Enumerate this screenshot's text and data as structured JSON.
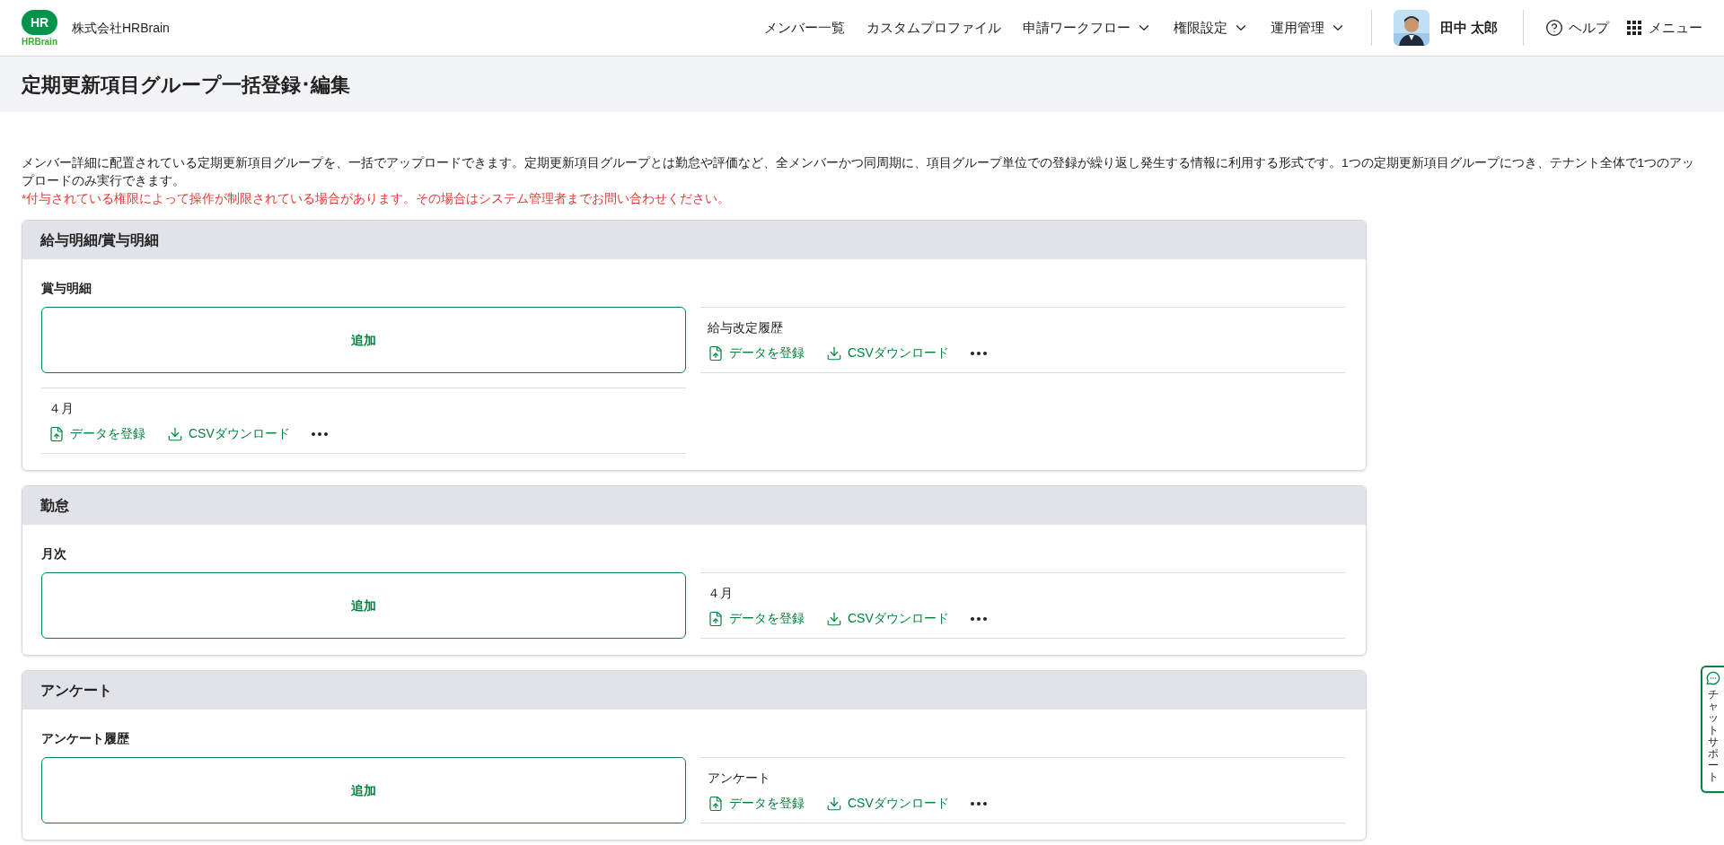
{
  "header": {
    "logo_mark": "HR",
    "logo_word": "HRBrain",
    "company": "株式会社HRBrain",
    "nav": [
      {
        "label": "メンバー一覧",
        "dropdown": false
      },
      {
        "label": "カスタムプロファイル",
        "dropdown": false
      },
      {
        "label": "申請ワークフロー",
        "dropdown": true
      },
      {
        "label": "権限設定",
        "dropdown": true
      },
      {
        "label": "運用管理",
        "dropdown": true
      }
    ],
    "user": {
      "name": "田中 太郎"
    },
    "help": "ヘルプ",
    "menu": "メニュー"
  },
  "page_title": "定期更新項目グループ一括登録･編集",
  "description": "メンバー詳細に配置されている定期更新項目グループを、一括でアップロードできます。定期更新項目グループとは勤怠や評価など、全メンバーかつ同周期に、項目グループ単位での登録が繰り返し発生する情報に利用する形式です。1つの定期更新項目グループにつき、テナント全体で1つのアップロードのみ実行できます。",
  "notice": "*付与されている権限によって操作が制限されている場合があります。その場合はシステム管理者までお問い合わせください。",
  "sections": [
    {
      "title": "給与明細/賞与明細",
      "group": "賞与明細",
      "add_label": "追加",
      "items": [
        {
          "name": "給与改定履歴",
          "register": "データを登録",
          "download": "CSVダウンロード"
        },
        {
          "name": "４月",
          "register": "データを登録",
          "download": "CSVダウンロード"
        }
      ]
    },
    {
      "title": "勤怠",
      "group": "月次",
      "add_label": "追加",
      "items": [
        {
          "name": "４月",
          "register": "データを登録",
          "download": "CSVダウンロード"
        }
      ]
    },
    {
      "title": "アンケート",
      "group": "アンケート履歴",
      "add_label": "追加",
      "items": [
        {
          "name": "アンケート",
          "register": "データを登録",
          "download": "CSVダウンロード"
        }
      ]
    }
  ],
  "chat_support": "チャットサポート"
}
